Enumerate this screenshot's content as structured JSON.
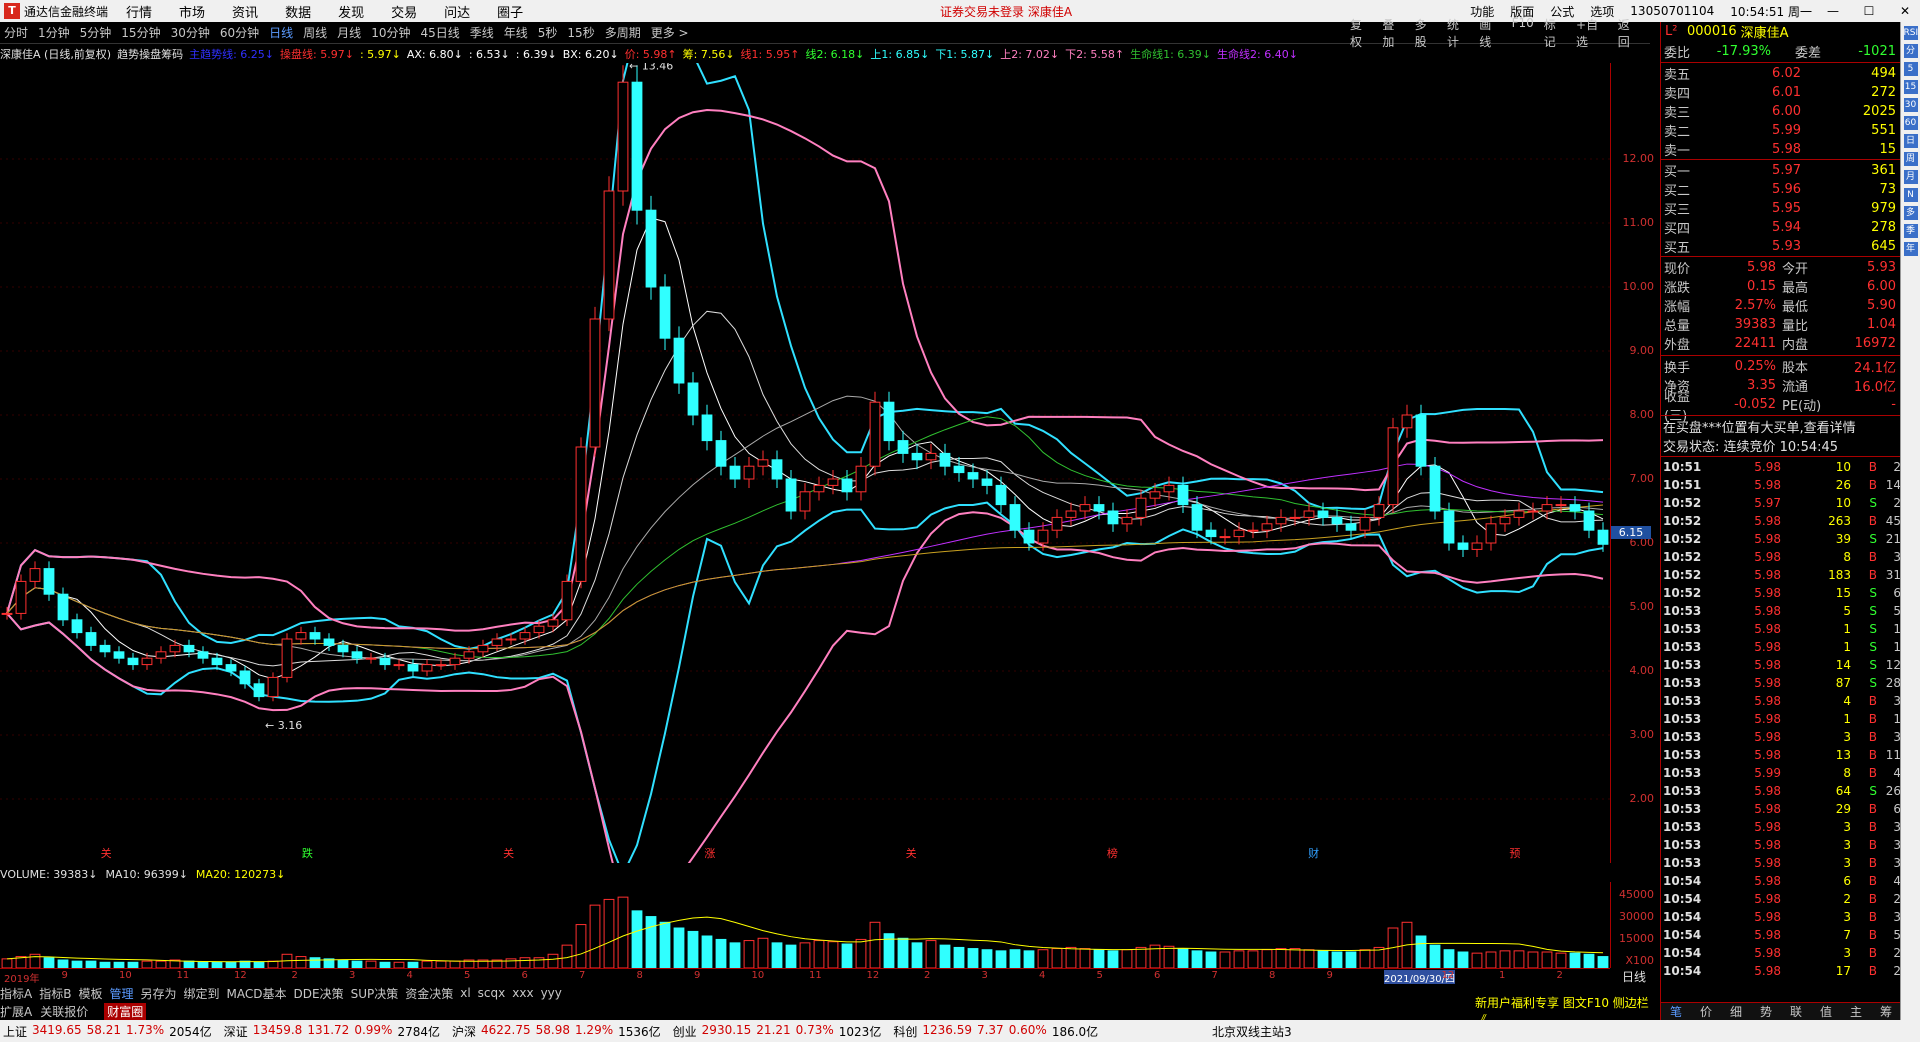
{
  "app": {
    "name": "通达信金融终端",
    "menu": [
      "行情",
      "市场",
      "资讯",
      "数据",
      "发现",
      "交易",
      "问达",
      "圈子"
    ],
    "notice": "证券交易未登录   深康佳A",
    "right_menu": [
      "功能",
      "版面",
      "公式",
      "选项"
    ],
    "account": "13050701104",
    "time": "10:54:51 周一"
  },
  "toolbar": {
    "periods": [
      "分时",
      "1分钟",
      "5分钟",
      "15分钟",
      "30分钟",
      "60分钟",
      "日线",
      "周线",
      "月线",
      "10分钟",
      "45日线",
      "季线",
      "年线",
      "5秒",
      "15秒",
      "多周期",
      "更多 >"
    ],
    "active_period": "日线",
    "tools": [
      "复权",
      "叠加",
      "多股",
      "统计",
      "画线",
      "F10",
      "标记",
      "+自选",
      "返回"
    ]
  },
  "indicator_header": [
    {
      "text": "深康佳A (日线,前复权)",
      "color": "#e0e0e0"
    },
    {
      "text": "趋势操盘筹码",
      "color": "#e0e0e0"
    },
    {
      "text": "主趋势线: 6.25↓",
      "color": "#3030ff"
    },
    {
      "text": "操盘线: 5.97↓",
      "color": "#ff3030"
    },
    {
      "text": ": 5.97↓",
      "color": "#ffff00"
    },
    {
      "text": "AX: 6.80↓",
      "color": "#ffffff"
    },
    {
      "text": ": 6.53↓",
      "color": "#ffffff"
    },
    {
      "text": ": 6.39↓",
      "color": "#ffffff"
    },
    {
      "text": "BX: 6.20↓",
      "color": "#ffffff"
    },
    {
      "text": "价: 5.98↑",
      "color": "#ff3030"
    },
    {
      "text": "筹: 7.56↓",
      "color": "#ffff00"
    },
    {
      "text": "线1: 5.95↑",
      "color": "#ff3030"
    },
    {
      "text": "线2: 6.18↓",
      "color": "#30ff30"
    },
    {
      "text": "上1: 6.85↓",
      "color": "#30ffff"
    },
    {
      "text": "下1: 5.87↓",
      "color": "#30ffff"
    },
    {
      "text": "上2: 7.02↓",
      "color": "#ff80c0"
    },
    {
      "text": "下2: 5.58↑",
      "color": "#ff80c0"
    },
    {
      "text": "生命线1: 6.39↓",
      "color": "#30c030"
    },
    {
      "text": "生命线2: 6.40↓",
      "color": "#c030ff"
    }
  ],
  "chart_data": {
    "type": "candlestick",
    "ylim": [
      1.0,
      13.5
    ],
    "y_ticks": [
      2.0,
      3.0,
      4.0,
      5.0,
      6.0,
      7.0,
      8.0,
      9.0,
      10.0,
      11.0,
      12.0
    ],
    "price_tag": "6.15",
    "high_label": "13.46",
    "low_label": "3.16",
    "x_labels": [
      "2019年",
      "9",
      "10",
      "11",
      "12",
      "2",
      "3",
      "4",
      "5",
      "6",
      "7",
      "8",
      "9",
      "10",
      "11",
      "12",
      "2",
      "3",
      "4",
      "5",
      "6",
      "7",
      "8",
      "9",
      "2021/09/30/四",
      "12",
      "1",
      "2"
    ],
    "event_markers": [
      "关",
      "跌",
      "关",
      "涨",
      "关",
      "榜",
      "财",
      "预"
    ],
    "close_series": [
      4.9,
      5.4,
      5.6,
      5.2,
      4.8,
      4.6,
      4.4,
      4.3,
      4.2,
      4.1,
      4.2,
      4.3,
      4.4,
      4.3,
      4.2,
      4.1,
      4.0,
      3.8,
      3.6,
      3.9,
      4.5,
      4.6,
      4.5,
      4.4,
      4.3,
      4.2,
      4.2,
      4.1,
      4.1,
      4.0,
      4.1,
      4.1,
      4.2,
      4.3,
      4.4,
      4.5,
      4.5,
      4.6,
      4.7,
      4.8,
      5.4,
      7.5,
      9.5,
      11.5,
      13.2,
      11.2,
      10.0,
      9.2,
      8.5,
      8.0,
      7.6,
      7.2,
      7.0,
      7.2,
      7.3,
      7.0,
      6.5,
      6.8,
      6.9,
      7.0,
      6.8,
      7.2,
      8.2,
      7.6,
      7.4,
      7.3,
      7.4,
      7.2,
      7.1,
      7.0,
      6.9,
      6.6,
      6.2,
      6.0,
      6.2,
      6.4,
      6.5,
      6.6,
      6.5,
      6.3,
      6.4,
      6.7,
      6.8,
      6.9,
      6.6,
      6.2,
      6.1,
      6.1,
      6.2,
      6.2,
      6.3,
      6.4,
      6.4,
      6.5,
      6.4,
      6.3,
      6.2,
      6.4,
      6.6,
      7.8,
      8.0,
      7.2,
      6.5,
      6.0,
      5.9,
      6.0,
      6.3,
      6.4,
      6.5,
      6.5,
      6.6,
      6.6,
      6.5,
      6.2,
      5.98
    ],
    "volume": {
      "label": "VOLUME: 39383↓",
      "ma10": "MA10: 96399↓",
      "ma20": "MA20: 120273↓",
      "y_ticks": [
        "45000",
        "30000",
        "15000",
        "X100"
      ]
    },
    "volume_series": [
      8,
      10,
      12,
      9,
      7,
      6,
      6,
      5,
      5,
      5,
      6,
      6,
      7,
      6,
      5,
      5,
      5,
      6,
      5,
      6,
      12,
      10,
      9,
      8,
      7,
      6,
      6,
      5,
      5,
      5,
      6,
      6,
      6,
      7,
      7,
      7,
      8,
      9,
      9,
      12,
      20,
      38,
      55,
      60,
      62,
      50,
      45,
      40,
      35,
      32,
      28,
      25,
      22,
      24,
      26,
      22,
      20,
      22,
      24,
      23,
      21,
      25,
      40,
      30,
      26,
      22,
      24,
      20,
      18,
      17,
      16,
      15,
      16,
      15,
      16,
      17,
      18,
      17,
      16,
      15,
      16,
      18,
      20,
      19,
      17,
      15,
      14,
      14,
      15,
      15,
      16,
      17,
      17,
      16,
      15,
      14,
      14,
      16,
      18,
      35,
      40,
      28,
      20,
      16,
      14,
      13,
      14,
      15,
      15,
      14,
      14,
      13,
      13,
      12,
      10
    ]
  },
  "xaxis_period": "日线",
  "bottom_tabs1": [
    "指标A",
    "指标B",
    "模板",
    "管理",
    "另存为",
    "绑定到",
    "MACD基本",
    "DDE决策",
    "SUP决策",
    "资金决策",
    "xl",
    "scqx",
    "xxx",
    "yyy"
  ],
  "bottom_tabs1_active": "管理",
  "bottom_tabs2": [
    "扩展A",
    "关联报价"
  ],
  "bottom_tabs2_red": "财富圈",
  "promo": "新用户福利专享 图文F10 侧边栏《",
  "status": [
    {
      "name": "上证",
      "val": "3419.65",
      "chg": "58.21",
      "pct": "1.73%",
      "amt": "2054亿"
    },
    {
      "name": "深证",
      "val": "13459.8",
      "chg": "131.72",
      "pct": "0.99%",
      "amt": "2784亿"
    },
    {
      "name": "沪深",
      "val": "4622.75",
      "chg": "58.98",
      "pct": "1.29%",
      "amt": "1536亿"
    },
    {
      "name": "创业",
      "val": "2930.15",
      "chg": "21.21",
      "pct": "0.73%",
      "amt": "1023亿"
    },
    {
      "name": "科创",
      "val": "1236.59",
      "chg": "7.37",
      "pct": "0.60%",
      "amt": "186.0亿"
    }
  ],
  "server": "北京双线主站3",
  "quote": {
    "code": "000016",
    "name": "深康佳A",
    "weibi_label": "委比",
    "weibi": "-17.93%",
    "weicha_label": "委差",
    "weicha": "-1021",
    "sells": [
      {
        "label": "卖五",
        "price": "6.02",
        "vol": "494"
      },
      {
        "label": "卖四",
        "price": "6.01",
        "vol": "272"
      },
      {
        "label": "卖三",
        "price": "6.00",
        "vol": "2025"
      },
      {
        "label": "卖二",
        "price": "5.99",
        "vol": "551"
      },
      {
        "label": "卖一",
        "price": "5.98",
        "vol": "15"
      }
    ],
    "buys": [
      {
        "label": "买一",
        "price": "5.97",
        "vol": "361"
      },
      {
        "label": "买二",
        "price": "5.96",
        "vol": "73"
      },
      {
        "label": "买三",
        "price": "5.95",
        "vol": "979"
      },
      {
        "label": "买四",
        "price": "5.94",
        "vol": "278"
      },
      {
        "label": "买五",
        "price": "5.93",
        "vol": "645"
      }
    ],
    "stats": [
      {
        "k1": "现价",
        "v1": "5.98",
        "k2": "今开",
        "v2": "5.93"
      },
      {
        "k1": "涨跌",
        "v1": "0.15",
        "k2": "最高",
        "v2": "6.00"
      },
      {
        "k1": "涨幅",
        "v1": "2.57%",
        "k2": "最低",
        "v2": "5.90"
      },
      {
        "k1": "总量",
        "v1": "39383",
        "k2": "量比",
        "v2": "1.04"
      },
      {
        "k1": "外盘",
        "v1": "22411",
        "k2": "内盘",
        "v2": "16972"
      }
    ],
    "stats2": [
      {
        "k1": "换手",
        "v1": "0.25%",
        "k2": "股本",
        "v2": "24.1亿"
      },
      {
        "k1": "净资",
        "v1": "3.35",
        "k2": "流通",
        "v2": "16.0亿"
      },
      {
        "k1": "收益(三)",
        "v1": "-0.052",
        "k2": "PE(动)",
        "v2": "-"
      }
    ],
    "news": "在买盘***位置有大买单,查看详情",
    "trade_status": "交易状态: 连续竞价 10:54:45",
    "ticks": [
      [
        "10:51",
        "5.98",
        "10",
        "B",
        "2"
      ],
      [
        "10:51",
        "5.98",
        "26",
        "B",
        "14"
      ],
      [
        "10:52",
        "5.97",
        "10",
        "S",
        "2"
      ],
      [
        "10:52",
        "5.98",
        "263",
        "B",
        "45"
      ],
      [
        "10:52",
        "5.98",
        "39",
        "S",
        "21"
      ],
      [
        "10:52",
        "5.98",
        "8",
        "B",
        "3"
      ],
      [
        "10:52",
        "5.98",
        "183",
        "B",
        "31"
      ],
      [
        "10:52",
        "5.98",
        "15",
        "S",
        "6"
      ],
      [
        "10:53",
        "5.98",
        "5",
        "S",
        "5"
      ],
      [
        "10:53",
        "5.98",
        "1",
        "S",
        "1"
      ],
      [
        "10:53",
        "5.98",
        "1",
        "S",
        "1"
      ],
      [
        "10:53",
        "5.98",
        "14",
        "S",
        "12"
      ],
      [
        "10:53",
        "5.98",
        "87",
        "S",
        "28"
      ],
      [
        "10:53",
        "5.98",
        "4",
        "B",
        "3"
      ],
      [
        "10:53",
        "5.98",
        "1",
        "B",
        "1"
      ],
      [
        "10:53",
        "5.98",
        "3",
        "B",
        "3"
      ],
      [
        "10:53",
        "5.98",
        "13",
        "B",
        "11"
      ],
      [
        "10:53",
        "5.99",
        "8",
        "B",
        "4"
      ],
      [
        "10:53",
        "5.98",
        "64",
        "S",
        "26"
      ],
      [
        "10:53",
        "5.98",
        "29",
        "B",
        "6"
      ],
      [
        "10:53",
        "5.98",
        "3",
        "B",
        "3"
      ],
      [
        "10:53",
        "5.98",
        "3",
        "B",
        "3"
      ],
      [
        "10:53",
        "5.98",
        "3",
        "B",
        "3"
      ],
      [
        "10:54",
        "5.98",
        "6",
        "B",
        "4"
      ],
      [
        "10:54",
        "5.98",
        "2",
        "B",
        "2"
      ],
      [
        "10:54",
        "5.98",
        "3",
        "B",
        "3"
      ],
      [
        "10:54",
        "5.98",
        "7",
        "B",
        "5"
      ],
      [
        "10:54",
        "5.98",
        "3",
        "B",
        "2"
      ],
      [
        "10:54",
        "5.98",
        "17",
        "B",
        "2"
      ]
    ],
    "tabs": [
      "笔",
      "价",
      "细",
      "势",
      "联",
      "值",
      "主",
      "筹"
    ],
    "active_tab": "笔"
  },
  "sidebar_icons": [
    "RSI",
    "分",
    "5",
    "15",
    "30",
    "60",
    "日",
    "周",
    "月",
    "N",
    "多",
    "季",
    "年"
  ]
}
